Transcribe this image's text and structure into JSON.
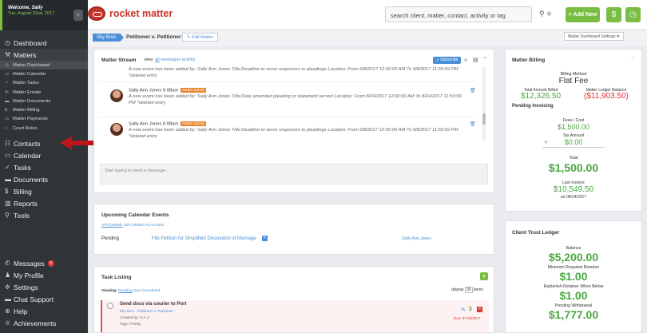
{
  "sidebar": {
    "welcome": "Welcome, Sally",
    "date": "Tue, August 22nd, 2017",
    "collapse_icon": "chevron-left",
    "nav": [
      {
        "label": "Dashboard",
        "icon": "clock"
      },
      {
        "label": "Matters",
        "icon": "gavel"
      }
    ],
    "matter_sub": [
      {
        "label": "Matter Dashboard",
        "icon": "clock"
      },
      {
        "label": "Matter Calendar",
        "icon": "calendar"
      },
      {
        "label": "Matter Tasks",
        "icon": "check"
      },
      {
        "label": "Matter Emails",
        "icon": "envelope"
      },
      {
        "label": "Matter Documents",
        "icon": "folder"
      },
      {
        "label": "Matter Billing",
        "icon": "dollar"
      },
      {
        "label": "Matter Payments",
        "icon": "card"
      },
      {
        "label": "Court Rules",
        "icon": "bank"
      }
    ],
    "nav2": [
      {
        "label": "Contacts",
        "icon": "people"
      },
      {
        "label": "Calendar",
        "icon": "calendar"
      },
      {
        "label": "Tasks",
        "icon": "check"
      },
      {
        "label": "Documents",
        "icon": "folder"
      },
      {
        "label": "Billing",
        "icon": "dollar"
      },
      {
        "label": "Reports",
        "icon": "chart"
      },
      {
        "label": "Tools",
        "icon": "wrench"
      }
    ],
    "bottom": [
      {
        "label": "Messages",
        "icon": "phone",
        "badge": "5"
      },
      {
        "label": "My Profile",
        "icon": "user"
      },
      {
        "label": "Settings",
        "icon": "gear"
      },
      {
        "label": "Chat Support",
        "icon": "chat"
      },
      {
        "label": "Help",
        "icon": "plus-circle"
      },
      {
        "label": "Achievements",
        "icon": "trophy"
      }
    ]
  },
  "topbar": {
    "brand": "rocket matter",
    "search_placeholder": "search client, matter, contact, activity or tag",
    "add_new": "+ Add New",
    "dollar_icon": "$",
    "clock_icon": "clock"
  },
  "matter_header": {
    "client": "Sky Bros",
    "title": "Petitioner v. Petitioner",
    "edit": "Edit Matter",
    "dashboard_settings": "Matter Dashboard Settings"
  },
  "stream": {
    "title": "Matter Stream",
    "view_label": "view:",
    "filters": [
      "all",
      "messages",
      "activity"
    ],
    "subscribe": "Subscribe",
    "truncated_text": "A new event has been added by: Sally Ann Jones Title:Deadline to serve responses to pleadings Location: From:9/8/2017 12:00:00 AM To 9/8/2017 11:59:59 PM *deleted entry",
    "entries": [
      {
        "author": "Sally Ann Jones",
        "time": "6:08am",
        "tag": "matter activity",
        "text": "A new event has been added by: Sally Ann Jones Title:Date amended pleading or statement served Location: From:8/24/2017 12:00:00 AM To 8/24/2017 11:59:59 PM *deleted entry"
      },
      {
        "author": "Sally Ann Jones",
        "time": "6:08am",
        "tag": "matter activity",
        "text": "A new event has been added by: Sally Ann Jones Title:Deadline to serve responses to pleadings Location: From:9/8/2017 12:00:00 AM To 9/8/2017 11:59:59 PM *deleted entry"
      }
    ],
    "message_placeholder": "Start typing to send a message..."
  },
  "calendar": {
    "title": "Upcoming Calendar Events",
    "tabs": [
      "UPCOMING",
      "UPCOMING FLAGGED"
    ],
    "row": {
      "status": "Pending",
      "event": "File Petition for Simplified Dissolution of Marriage",
      "person": "Sally Ann Jones"
    }
  },
  "tasks": {
    "title": "Task Listing",
    "viewing_label": "Viewing:",
    "filters": [
      "Pending",
      "Due",
      "Completed"
    ],
    "display_label": "display",
    "display_count": "30",
    "items_label": "items",
    "task": {
      "title": "Send docs via courier to Port",
      "matter": "Sky Bros : Petitioner v. Petitioner",
      "created": "Created by: S.A.J.",
      "tags": "Tags: Priority",
      "due": "Due: 07/18/2017"
    }
  },
  "billing": {
    "title": "Matter Billing",
    "method_label": "Billing Method",
    "method": "Flat Fee",
    "total_billed_label": "Total Amount Billed",
    "total_billed": "$12,326.50",
    "ledger_label": "Matter Ledger Balance",
    "ledger": "($11,903.50)",
    "pending_label": "Pending Invoicing",
    "fees_label": "Fees / Cost",
    "fees": "$1,500.00",
    "tax_label": "Tax Amount",
    "tax": "$0.00",
    "total_label": "Total",
    "total": "$1,500.00",
    "last_label": "Last Invoice",
    "last": "$10,549.50",
    "last_date": "on 08/14/2017"
  },
  "trust": {
    "title": "Client Trust Ledger",
    "balance_label": "Balance",
    "balance": "$5,200.00",
    "min_label": "Minimum Required Retainer",
    "min": "$1.00",
    "replenish_label": "Replenish Retainer When Below",
    "replenish": "$1.00",
    "withdrawal_label": "Pending Withdrawal",
    "withdrawal": "$1,777.00"
  }
}
